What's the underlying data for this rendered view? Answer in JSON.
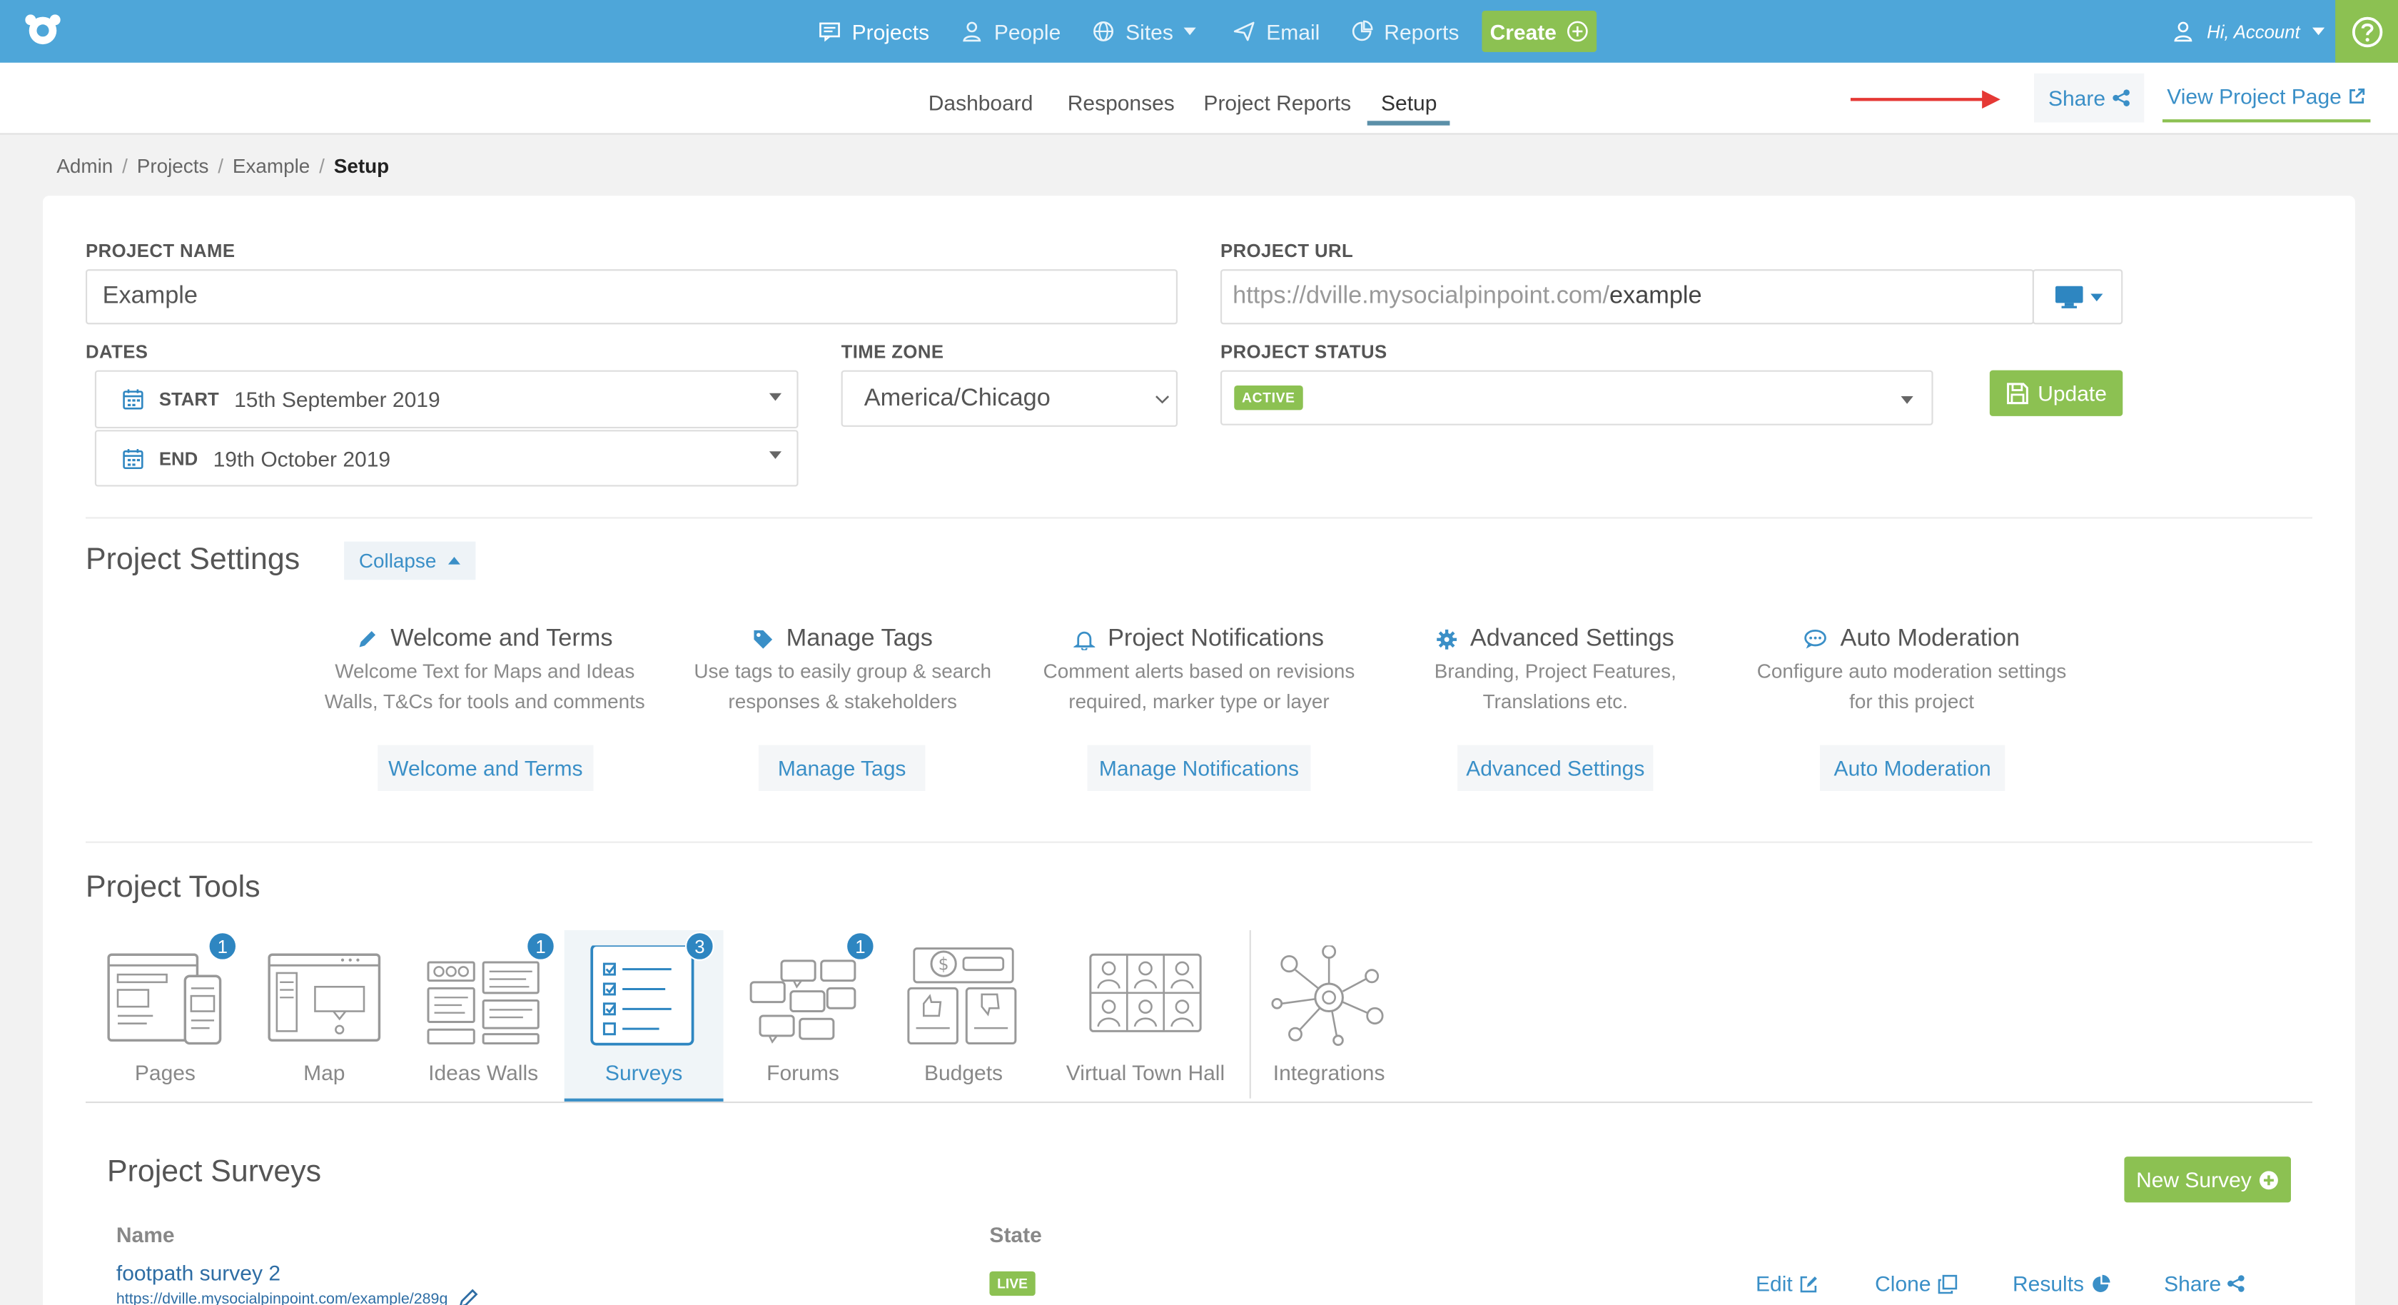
{
  "nav": {
    "items": [
      {
        "label": "Projects",
        "icon": "projects-icon"
      },
      {
        "label": "People",
        "icon": "person-icon"
      },
      {
        "label": "Sites",
        "icon": "globe-icon"
      },
      {
        "label": "Email",
        "icon": "send-icon"
      },
      {
        "label": "Reports",
        "icon": "reports-icon"
      }
    ],
    "create_label": "Create",
    "account_label": "Hi, Account"
  },
  "subnav": {
    "tabs": [
      "Dashboard",
      "Responses",
      "Project Reports",
      "Setup"
    ],
    "active_tab": "Setup",
    "share_label": "Share",
    "view_project_label": "View Project Page"
  },
  "breadcrumb": {
    "items": [
      "Admin",
      "Projects",
      "Example",
      "Setup"
    ]
  },
  "form": {
    "project_name_label": "PROJECT NAME",
    "project_name_value": "Example",
    "project_url_label": "PROJECT URL",
    "project_url_prefix": "https://dville.mysocialpinpoint.com/",
    "project_url_slug": "example",
    "dates_label": "DATES",
    "start_label": "START",
    "start_value": "15th September 2019",
    "end_label": "END",
    "end_value": "19th October 2019",
    "timezone_label": "TIME ZONE",
    "timezone_value": "America/Chicago",
    "status_label": "PROJECT STATUS",
    "status_value": "ACTIVE",
    "update_label": "Update"
  },
  "settings": {
    "title": "Project Settings",
    "collapse_label": "Collapse",
    "items": [
      {
        "title": "Welcome and Terms",
        "desc1": "Welcome Text for Maps and Ideas",
        "desc2": "Walls, T&Cs for tools and comments",
        "button": "Welcome and Terms",
        "icon": "pencil-icon"
      },
      {
        "title": "Manage Tags",
        "desc1": "Use tags to easily group & search",
        "desc2": "responses & stakeholders",
        "button": "Manage Tags",
        "icon": "tag-icon"
      },
      {
        "title": "Project Notifications",
        "desc1": "Comment alerts based on revisions",
        "desc2": "required, marker type or layer",
        "button": "Manage Notifications",
        "icon": "bell-icon"
      },
      {
        "title": "Advanced Settings",
        "desc1": "Branding, Project Features,",
        "desc2": "Translations etc.",
        "button": "Advanced Settings",
        "icon": "gear-icon"
      },
      {
        "title": "Auto Moderation",
        "desc1": "Configure auto moderation settings",
        "desc2": "for this project",
        "button": "Auto Moderation",
        "icon": "chat-icon"
      }
    ]
  },
  "tools": {
    "title": "Project Tools",
    "items": [
      {
        "label": "Pages",
        "count": "1"
      },
      {
        "label": "Map",
        "count": ""
      },
      {
        "label": "Ideas Walls",
        "count": "1"
      },
      {
        "label": "Surveys",
        "count": "3"
      },
      {
        "label": "Forums",
        "count": "1"
      },
      {
        "label": "Budgets",
        "count": ""
      },
      {
        "label": "Virtual Town Hall",
        "count": ""
      },
      {
        "label": "Integrations",
        "count": ""
      }
    ],
    "active": "Surveys"
  },
  "surveys": {
    "title": "Project Surveys",
    "new_label": "New Survey",
    "col_name": "Name",
    "col_state": "State",
    "rows": [
      {
        "name": "footpath survey 2",
        "url": "https://dville.mysocialpinpoint.com/example/289g",
        "state": "LIVE"
      }
    ],
    "actions": [
      "Edit",
      "Clone",
      "Results",
      "Share"
    ]
  },
  "colors": {
    "topbar": "#4ea6d9",
    "accent_green": "#8cc152",
    "link_blue": "#3a8fc7"
  }
}
